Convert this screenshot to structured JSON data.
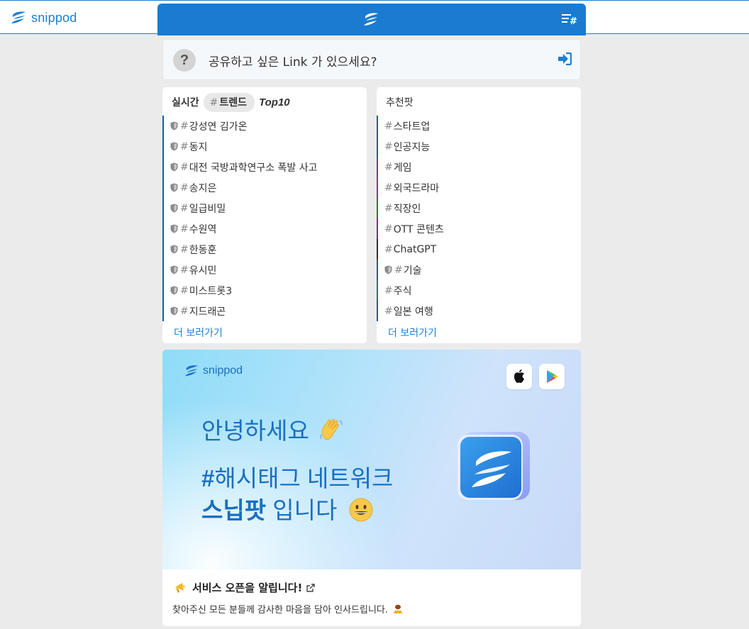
{
  "header": {
    "brand": "snippod",
    "colors": {
      "accent": "#1a7bd0",
      "brand": "#1a7fd4"
    }
  },
  "link_bar": {
    "help_glyph": "?",
    "prompt": "공유하고 싶은 Link 가 있으세요?"
  },
  "realtime": {
    "title": "실시간",
    "pill_hash": "#",
    "pill_label": "트렌드",
    "badge": "Top10",
    "items": [
      {
        "label": "강성연 김가온"
      },
      {
        "label": "동지"
      },
      {
        "label": "대전 국방과학연구소 폭발 사고"
      },
      {
        "label": "송지은"
      },
      {
        "label": "일급비밀"
      },
      {
        "label": "수원역"
      },
      {
        "label": "한동훈"
      },
      {
        "label": "유시민"
      },
      {
        "label": "미스트롯3"
      },
      {
        "label": "지드래곤"
      }
    ],
    "more": "더 보러가기"
  },
  "recommended": {
    "title": "추천팟",
    "items": [
      {
        "label": "스타트업",
        "color": "#1a5fa0",
        "shield": false
      },
      {
        "label": "인공지능",
        "color": "#1a5fa0",
        "shield": false
      },
      {
        "label": "게임",
        "color": "#6a3fa0",
        "shield": false
      },
      {
        "label": "외국드라마",
        "color": "#a0307a",
        "shield": false
      },
      {
        "label": "직장인",
        "color": "#2a7a3a",
        "shield": false
      },
      {
        "label": "OTT 콘텐츠",
        "color": "#8a2a8a",
        "shield": false
      },
      {
        "label": "ChatGPT",
        "color": "#333333",
        "shield": false
      },
      {
        "label": "기술",
        "color": "#1a5fa0",
        "shield": true
      },
      {
        "label": "주식",
        "color": "#1a7f6a",
        "shield": false
      },
      {
        "label": "일본 여행",
        "color": "#1a5fa0",
        "shield": false
      }
    ],
    "hash": "#",
    "more": "더 보러가기"
  },
  "banner": {
    "brand": "snippod",
    "hello": "안녕하세요",
    "line1_hash": "#",
    "line1_rest": "해시태그 네트워크",
    "line2_bold": "스닙팟",
    "line2_rest": " 입니다",
    "news_title": "서비스 오픈을 알립니다!",
    "news_desc": "찾아주신 모든 분들께 감사한 마음을 담아 인사드립니다."
  }
}
